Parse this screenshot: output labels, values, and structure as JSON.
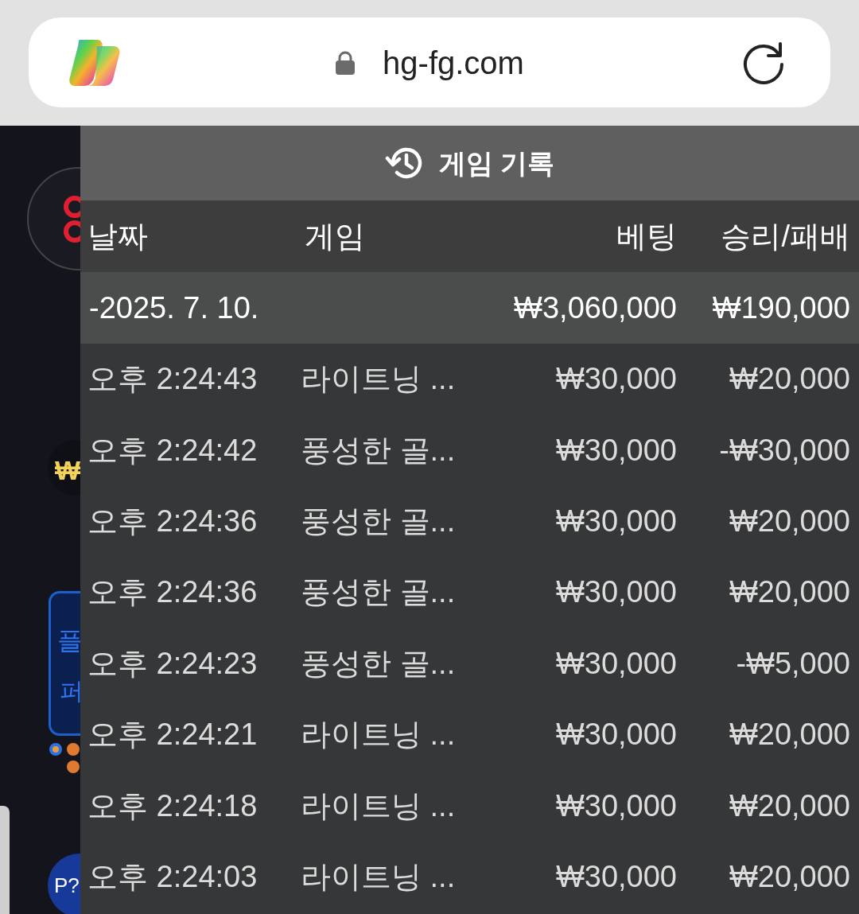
{
  "browser": {
    "url": "hg-fg.com"
  },
  "background": {
    "coin_symbol": "₩",
    "promo_fragments": [
      "플",
      "퍼"
    ],
    "avatar": "P?"
  },
  "panel": {
    "title": "게임 기록",
    "columns": [
      "날짜",
      "게임",
      "베팅",
      "승리/패배"
    ],
    "date_row": {
      "date": "-2025. 7. 10.",
      "bet": "₩3,060,000",
      "result": "₩190,000"
    },
    "rows": [
      {
        "time": "오후 2:24:43",
        "game": "라이트닝 ...",
        "bet": "₩30,000",
        "result": "₩20,000"
      },
      {
        "time": "오후 2:24:42",
        "game": "풍성한 골...",
        "bet": "₩30,000",
        "result": "-₩30,000"
      },
      {
        "time": "오후 2:24:36",
        "game": "풍성한 골...",
        "bet": "₩30,000",
        "result": "₩20,000"
      },
      {
        "time": "오후 2:24:36",
        "game": "풍성한 골...",
        "bet": "₩30,000",
        "result": "₩20,000"
      },
      {
        "time": "오후 2:24:23",
        "game": "풍성한 골...",
        "bet": "₩30,000",
        "result": "-₩5,000"
      },
      {
        "time": "오후 2:24:21",
        "game": "라이트닝 ...",
        "bet": "₩30,000",
        "result": "₩20,000"
      },
      {
        "time": "오후 2:24:18",
        "game": "라이트닝 ...",
        "bet": "₩30,000",
        "result": "₩20,000"
      },
      {
        "time": "오후 2:24:03",
        "game": "라이트닝 ...",
        "bet": "₩30,000",
        "result": "₩20,000"
      }
    ]
  }
}
